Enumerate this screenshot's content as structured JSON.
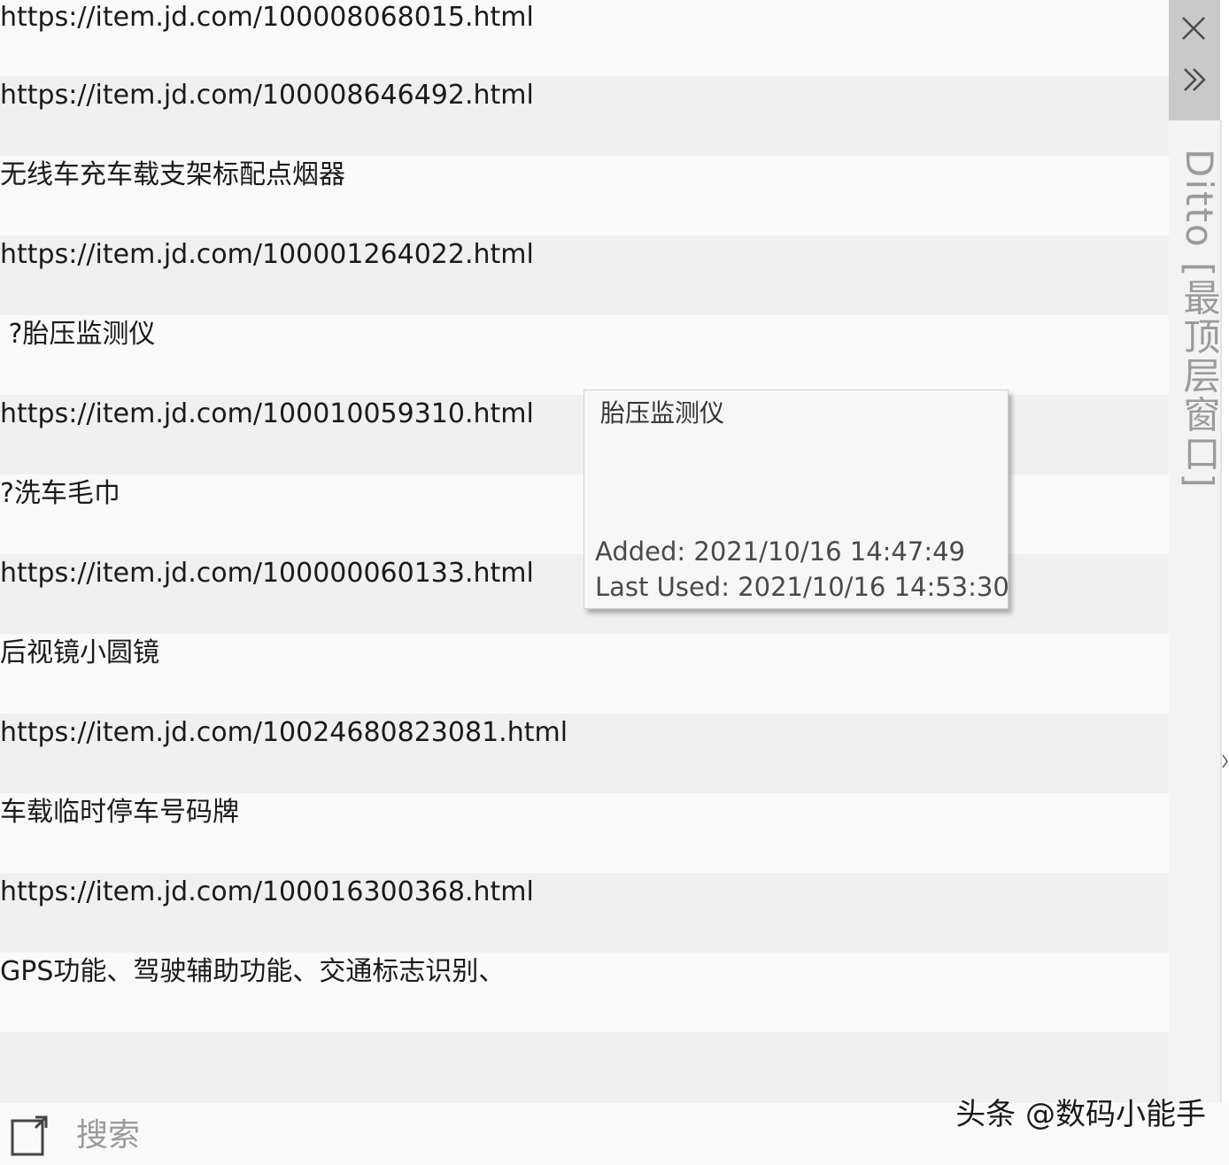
{
  "clips": [
    {
      "text": "https://item.jd.com/100008068015.html"
    },
    {
      "text": "https://item.jd.com/100008646492.html"
    },
    {
      "text": "无线车充车载支架标配点烟器"
    },
    {
      "text": "https://item.jd.com/100001264022.html"
    },
    {
      "text": " ?胎压监测仪"
    },
    {
      "text": "https://item.jd.com/100010059310.html"
    },
    {
      "text": "?洗车毛巾"
    },
    {
      "text": "https://item.jd.com/100000060133.html"
    },
    {
      "text": "后视镜小圆镜"
    },
    {
      "text": "https://item.jd.com/10024680823081.html"
    },
    {
      "text": "车载临时停车号码牌"
    },
    {
      "text": "https://item.jd.com/100016300368.html"
    },
    {
      "text": "GPS功能、驾驶辅助功能、交通标志识别、"
    }
  ],
  "tooltip": {
    "title": "胎压监测仪",
    "added": "Added: 2021/10/16 14:47:49",
    "last_used": "Last Used: 2021/10/16 14:53:30"
  },
  "side_panel": {
    "title": "Ditto [最顶层窗口]",
    "icons": {
      "close": "close-icon",
      "expand": "double-chevron-right-icon"
    }
  },
  "search": {
    "label": "搜索",
    "icon": "search-toggle-icon"
  },
  "watermark": "头条 @数码小能手",
  "colors": {
    "row_odd": "#fafafa",
    "row_even": "#f0f0f0",
    "button_area": "#c9c9c9",
    "side_text": "#9b9b9b"
  }
}
